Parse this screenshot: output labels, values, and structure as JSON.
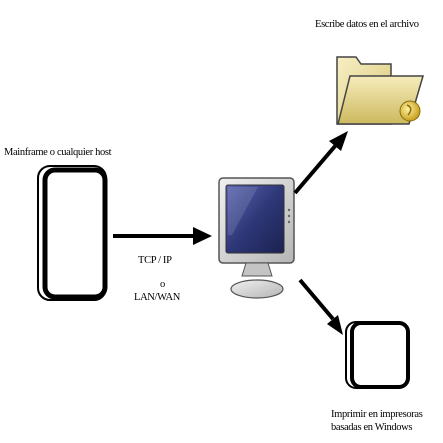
{
  "labels": {
    "file": "Escribe datos en el archivo",
    "host": "Mainframe o cualquier host",
    "link_line1": "TCP / IP",
    "link_line2": "o",
    "link_line3": "LAN/WAN",
    "printer_line1": "Imprimir en impresoras",
    "printer_line2": "basadas en Windows"
  },
  "icons": {
    "host": "mainframe-box-icon",
    "computer": "computer-monitor-icon",
    "file": "folder-icon",
    "printer": "printer-box-icon"
  },
  "colors": {
    "stroke": "#000000",
    "folder_fill": "#efe3a3",
    "screen": "#2e3878",
    "monitor_body": "#d6d6d6"
  }
}
